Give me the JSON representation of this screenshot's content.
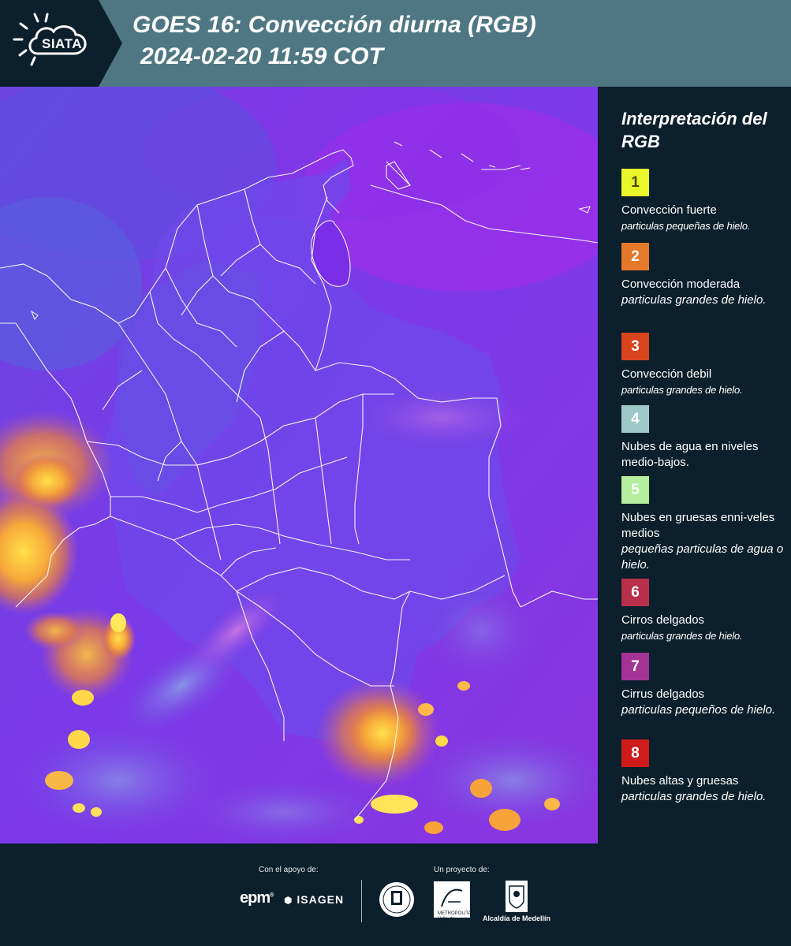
{
  "header": {
    "logo_text": "SIATA",
    "title": "GOES 16: Convección diurna (RGB)",
    "subtitle": "2024-02-20 11:59 COT"
  },
  "map": {
    "background_color": "#7a35e6",
    "boundary_color": "#ffffff"
  },
  "legend": {
    "title": "Interpretación del RGB",
    "items": [
      {
        "number": "1",
        "color": "#eaf52a",
        "text_color": "#4a4a10",
        "title": "Convección fuerte",
        "desc": "particulas pequeñas de hielo."
      },
      {
        "number": "2",
        "color": "#e6782a",
        "text_color": "#ffffff",
        "title": "Convección moderada",
        "desc": "particulas grandes de hielo."
      },
      {
        "number": "3",
        "color": "#d7441e",
        "text_color": "#ffffff",
        "title": "Convección debil",
        "desc": "particulas grandes de hielo."
      },
      {
        "number": "4",
        "color": "#9fc9c8",
        "text_color": "#ffffff",
        "title": "Nubes de agua en niveles medio-bajos.",
        "desc": ""
      },
      {
        "number": "5",
        "color": "#b4ee9e",
        "text_color": "#ffffff",
        "title": "Nubes en gruesas enni-veles medios",
        "desc": "pequeñas particulas de agua o hielo."
      },
      {
        "number": "6",
        "color": "#b8304a",
        "text_color": "#ffffff",
        "title": "Cirros delgados",
        "desc": "particulas grandes de hielo."
      },
      {
        "number": "7",
        "color": "#a43396",
        "text_color": "#ffffff",
        "title": "Cirrus delgados",
        "desc": "particulas pequeños de hielo."
      },
      {
        "number": "8",
        "color": "#cf1b1b",
        "text_color": "#ffffff",
        "title": "Nubes altas y gruesas",
        "desc": "particulas grandes de hielo."
      }
    ]
  },
  "footer": {
    "support_label": "Con el apoyo de:",
    "project_label": "Un proyecto de:",
    "sponsor_1": "epm",
    "sponsor_2": "ISAGEN",
    "area_text": "METROPOLITANA Valle de Aburrá",
    "alcaldia": "Alcaldía de Medellín"
  }
}
